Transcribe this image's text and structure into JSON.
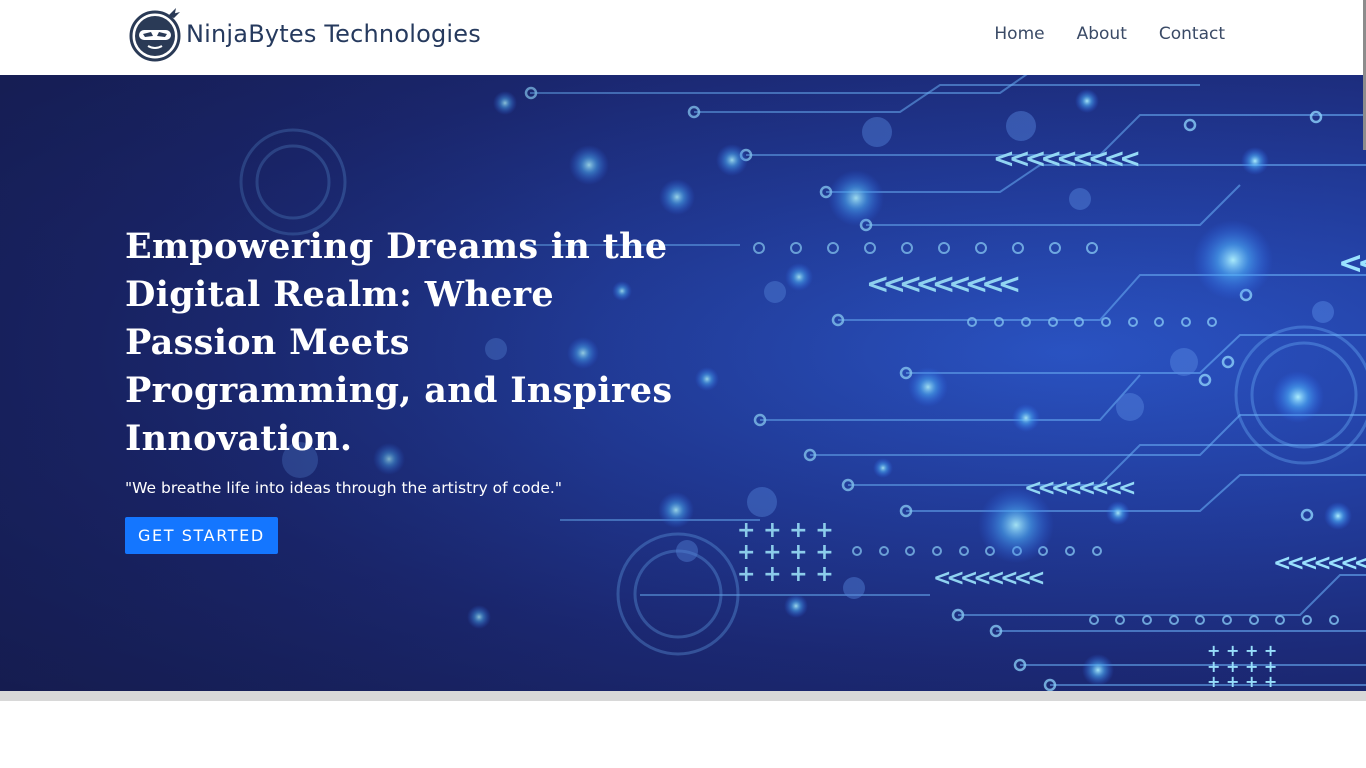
{
  "brand": {
    "name": "NinjaBytes Technologies",
    "logo_icon": "ninja-logo-icon"
  },
  "nav": {
    "items": [
      {
        "label": "Home"
      },
      {
        "label": "About"
      },
      {
        "label": "Contact"
      }
    ]
  },
  "hero": {
    "title": "Empowering Dreams in the Digital Realm: Where Passion Meets Programming, and Inspires Innovation.",
    "subtitle": "\"We breathe life into ideas through the artistry of code.\"",
    "cta_label": "GET STARTED"
  },
  "colors": {
    "accent": "#1476ff",
    "hero_bg_dark": "#161f57",
    "hero_bg_light": "#2b56c9",
    "circuit": "#7fc8ff",
    "brand_text": "#263a5e"
  }
}
